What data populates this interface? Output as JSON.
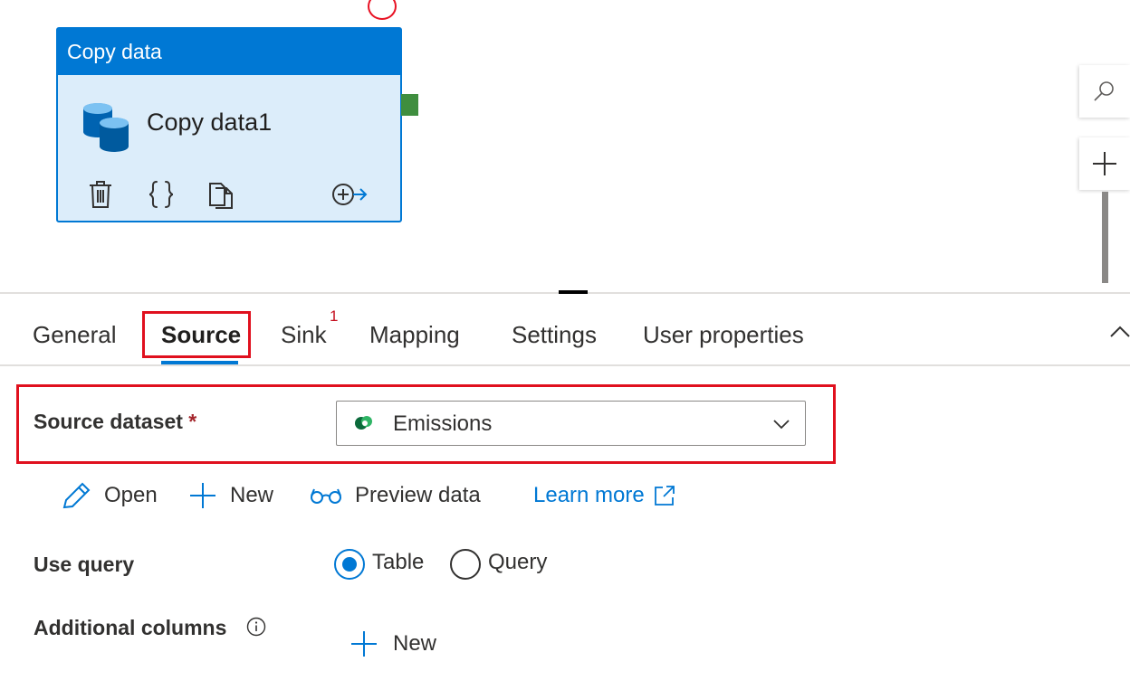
{
  "canvas": {
    "activity": {
      "type_label": "Copy data",
      "name": "Copy data1",
      "actions": [
        "delete-icon",
        "code-icon",
        "clone-icon",
        "add-output-icon"
      ]
    },
    "side_buttons": [
      "search-icon",
      "zoom-in-icon"
    ]
  },
  "tabs": [
    {
      "label": "General"
    },
    {
      "label": "Source",
      "active": true
    },
    {
      "label": "Sink",
      "badge": "1"
    },
    {
      "label": "Mapping"
    },
    {
      "label": "Settings"
    },
    {
      "label": "User properties"
    }
  ],
  "source": {
    "dataset_label": "Source dataset",
    "required_mark": "*",
    "dataset_value": "Emissions",
    "actions": {
      "open": "Open",
      "new": "New",
      "preview": "Preview data",
      "learn_more": "Learn more"
    },
    "use_query": {
      "label": "Use query",
      "options": [
        "Table",
        "Query"
      ],
      "selected": "Table"
    },
    "additional_columns": {
      "label": "Additional columns",
      "new_label": "New"
    }
  },
  "colors": {
    "accent": "#0078d4",
    "highlight": "#e0101e",
    "activity_bg": "#dcedfa",
    "success_port": "#3f8e3f"
  }
}
